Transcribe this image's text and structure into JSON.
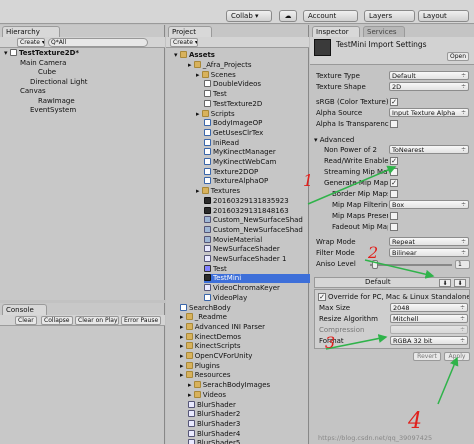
{
  "toolbar": {
    "collab": "Collab ▾",
    "account": "Account",
    "layers": "Layers",
    "layout": "Layout"
  },
  "hierarchy": {
    "tab": "Hierarchy",
    "create": "Create ▾",
    "search": "Q*All",
    "scene": "TestTexture2D*",
    "items": [
      "Main Camera",
      "Cube",
      "Directional Light",
      "Canvas",
      "RawImage",
      "EventSystem"
    ]
  },
  "console": {
    "tab": "Console",
    "buttons": [
      "Clear",
      "Collapse",
      "Clear on Play",
      "Error Pause"
    ]
  },
  "project": {
    "tab": "Project",
    "create": "Create ▾",
    "assets": "Assets",
    "tree": [
      {
        "label": "_Afra_Projects",
        "type": "folder"
      },
      {
        "label": "Scenes",
        "type": "folder"
      },
      {
        "label": "DoubleVideos",
        "type": "scene"
      },
      {
        "label": "Test",
        "type": "scene"
      },
      {
        "label": "TestTexture2D",
        "type": "scene"
      },
      {
        "label": "Scripts",
        "type": "folder"
      },
      {
        "label": "BodyImageOP",
        "type": "cs"
      },
      {
        "label": "GetUsesClrTex",
        "type": "cs"
      },
      {
        "label": "IniRead",
        "type": "cs"
      },
      {
        "label": "MyKinectManager",
        "type": "cs"
      },
      {
        "label": "MyKinectWebCam",
        "type": "cs"
      },
      {
        "label": "Texture2DOP",
        "type": "cs"
      },
      {
        "label": "TextureAlphaOP",
        "type": "cs"
      },
      {
        "label": "Textures",
        "type": "folder"
      },
      {
        "label": "20160329131835923",
        "type": "tex"
      },
      {
        "label": "20160329131848163",
        "type": "tex"
      },
      {
        "label": "Custom_NewSurfaceShad",
        "type": "go"
      },
      {
        "label": "Custom_NewSurfaceShad",
        "type": "go"
      },
      {
        "label": "MovieMaterial",
        "type": "go"
      },
      {
        "label": "NewSurfaceShader",
        "type": "shader"
      },
      {
        "label": "NewSurfaceShader 1",
        "type": "shader"
      },
      {
        "label": "Test",
        "type": "mov"
      },
      {
        "label": "TestMini",
        "type": "tex"
      },
      {
        "label": "VideoChromaKeyer",
        "type": "shader"
      },
      {
        "label": "VideoPlay",
        "type": "cs"
      },
      {
        "label": "SearchBody",
        "type": "cs"
      },
      {
        "label": "_Readme",
        "type": "folder"
      },
      {
        "label": "Advanced INI Parser",
        "type": "folder"
      },
      {
        "label": "KinectDemos",
        "type": "folder"
      },
      {
        "label": "KinectScripts",
        "type": "folder"
      },
      {
        "label": "OpenCVForUnity",
        "type": "folder"
      },
      {
        "label": "Plugins",
        "type": "folder"
      },
      {
        "label": "Resources",
        "type": "folder"
      },
      {
        "label": "SerachBodyImages",
        "type": "folder"
      },
      {
        "label": "Videos",
        "type": "folder"
      },
      {
        "label": "BlurShader",
        "type": "shader"
      },
      {
        "label": "BlurShader2",
        "type": "shader"
      },
      {
        "label": "BlurShader3",
        "type": "shader"
      },
      {
        "label": "BlurShader4",
        "type": "shader"
      },
      {
        "label": "BlurShader5",
        "type": "shader"
      }
    ]
  },
  "inspector": {
    "tab": "Inspector",
    "tab2": "Services",
    "title": "TestMini Import Settings",
    "open": "Open",
    "texture_type_label": "Texture Type",
    "texture_type": "Default",
    "texture_shape_label": "Texture Shape",
    "texture_shape": "2D",
    "srgb_label": "sRGB (Color Texture)",
    "alpha_source_label": "Alpha Source",
    "alpha_source": "Input Texture Alpha",
    "alpha_transparency_label": "Alpha Is Transparency",
    "advanced_label": "Advanced",
    "npot_label": "Non Power of 2",
    "npot": "ToNearest",
    "readwrite_label": "Read/Write Enabled",
    "streaming_label": "Streaming Mip Maps",
    "genmip_label": "Generate Mip Maps",
    "bordermip_label": "Border Mip Maps",
    "mipfilter_label": "Mip Map Filtering",
    "mipfilter": "Box",
    "mippreserve_label": "Mip Maps Preserve",
    "fadeout_label": "Fadeout Mip Maps",
    "wrap_label": "Wrap Mode",
    "wrap": "Repeat",
    "filter_label": "Filter Mode",
    "filter": "Bilinear",
    "aniso_label": "Aniso Level",
    "aniso_value": "1",
    "platform_tab": "Default",
    "override_label": "Override for PC, Mac & Linux Standalone",
    "maxsize_label": "Max Size",
    "maxsize": "2048",
    "resize_label": "Resize Algorithm",
    "resize": "Mitchell",
    "compression_label": "Compression",
    "compression": "",
    "format_label": "Format",
    "format": "RGBA 32 bit",
    "revert": "Revert",
    "apply": "Apply"
  },
  "annotations": {
    "n1": "1",
    "n2": "2",
    "n3": "3",
    "n4": "4"
  },
  "watermark": "https://blog.csdn.net/qq_39097425",
  "colors": {
    "annotation": "#e0201c",
    "arrow": "#2fb34a",
    "selection": "#3d6fd9"
  }
}
